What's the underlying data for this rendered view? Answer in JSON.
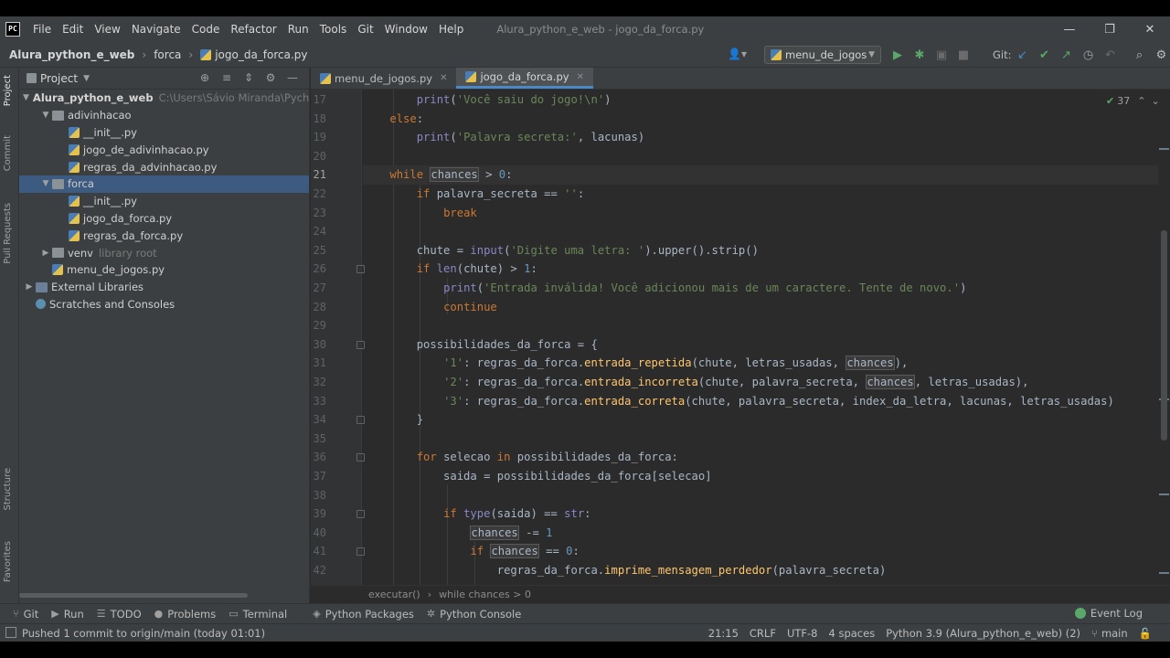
{
  "menubar": {
    "logo": "PC",
    "items": [
      "File",
      "Edit",
      "View",
      "Navigate",
      "Code",
      "Refactor",
      "Run",
      "Tools",
      "Git",
      "Window",
      "Help"
    ],
    "window_title": "Alura_python_e_web - jogo_da_forca.py"
  },
  "navbar": {
    "crumbs": [
      "Alura_python_e_web",
      "forca",
      "jogo_da_forca.py"
    ],
    "run_config": "menu_de_jogos",
    "git_label": "Git:"
  },
  "tool_strips": {
    "project": "Project",
    "commit": "Commit",
    "pull_requests": "Pull Requests",
    "structure": "Structure",
    "favorites": "Favorites"
  },
  "project": {
    "header": "Project",
    "tree": [
      {
        "label": "Alura_python_e_web",
        "hint": "C:\\Users\\Sávio Miranda\\PycharmProjects",
        "type": "folder",
        "arrow": "▼",
        "level": 0,
        "bold": true
      },
      {
        "label": "adivinhacao",
        "type": "folder",
        "arrow": "▼",
        "level": 1
      },
      {
        "label": "__init__.py",
        "type": "py",
        "level": 2
      },
      {
        "label": "jogo_de_adivinhacao.py",
        "type": "py",
        "level": 2
      },
      {
        "label": "regras_da_advinhacao.py",
        "type": "py",
        "level": 2
      },
      {
        "label": "forca",
        "type": "folder",
        "arrow": "▼",
        "level": 1,
        "selected": true
      },
      {
        "label": "__init__.py",
        "type": "py",
        "level": 2
      },
      {
        "label": "jogo_da_forca.py",
        "type": "py",
        "level": 2
      },
      {
        "label": "regras_da_forca.py",
        "type": "py",
        "level": 2
      },
      {
        "label": "venv",
        "hint": "library root",
        "type": "folder",
        "arrow": "▶",
        "level": 1
      },
      {
        "label": "menu_de_jogos.py",
        "type": "py",
        "level": 1
      },
      {
        "label": "External Libraries",
        "type": "lib",
        "arrow": "▶",
        "level": 0
      },
      {
        "label": "Scratches and Consoles",
        "type": "scratch",
        "level": 0
      }
    ]
  },
  "tabs": [
    {
      "label": "menu_de_jogos.py",
      "active": false
    },
    {
      "label": "jogo_da_forca.py",
      "active": true
    }
  ],
  "editor": {
    "inspection_count": "37",
    "lines": [
      {
        "n": "17",
        "tokens": [
          [
            "",
            "        "
          ],
          [
            "fn2",
            "print"
          ],
          [
            "",
            "("
          ],
          [
            "str",
            "'Você saiu do jogo!\\n'"
          ],
          [
            "",
            ")"
          ]
        ]
      },
      {
        "n": "18",
        "tokens": [
          [
            "",
            "    "
          ],
          [
            "kw",
            "else"
          ],
          [
            "",
            ":"
          ]
        ]
      },
      {
        "n": "19",
        "tokens": [
          [
            "",
            "        "
          ],
          [
            "fn2",
            "print"
          ],
          [
            "",
            "("
          ],
          [
            "str",
            "'Palavra secreta:'"
          ],
          [
            "",
            ", lacunas)"
          ]
        ]
      },
      {
        "n": "20",
        "tokens": []
      },
      {
        "n": "21",
        "tokens": [
          [
            "",
            "    "
          ],
          [
            "kw",
            "while "
          ],
          [
            "hl",
            "chances"
          ],
          [
            "",
            " > "
          ],
          [
            "num",
            "0"
          ],
          [
            "",
            ":"
          ]
        ]
      },
      {
        "n": "22",
        "tokens": [
          [
            "",
            "        "
          ],
          [
            "kw",
            "if "
          ],
          [
            "",
            "palavra_secreta == "
          ],
          [
            "str",
            "''"
          ],
          [
            "",
            ":"
          ]
        ]
      },
      {
        "n": "23",
        "tokens": [
          [
            "",
            "            "
          ],
          [
            "kw",
            "break"
          ]
        ]
      },
      {
        "n": "24",
        "tokens": []
      },
      {
        "n": "25",
        "tokens": [
          [
            "",
            "        chute = "
          ],
          [
            "fn2",
            "input"
          ],
          [
            "",
            "("
          ],
          [
            "str",
            "'Digite uma letra: '"
          ],
          [
            "",
            ").upper().strip()"
          ]
        ]
      },
      {
        "n": "26",
        "tokens": [
          [
            "",
            "        "
          ],
          [
            "kw",
            "if "
          ],
          [
            "bi",
            "len"
          ],
          [
            "",
            "(chute) > "
          ],
          [
            "num",
            "1"
          ],
          [
            "",
            ":"
          ]
        ]
      },
      {
        "n": "27",
        "tokens": [
          [
            "",
            "            "
          ],
          [
            "fn2",
            "print"
          ],
          [
            "",
            "("
          ],
          [
            "str",
            "'Entrada inválida! Você adicionou mais de um caractere. Tente de novo.'"
          ],
          [
            "",
            ")"
          ]
        ]
      },
      {
        "n": "28",
        "tokens": [
          [
            "",
            "            "
          ],
          [
            "kw",
            "continue"
          ]
        ]
      },
      {
        "n": "29",
        "tokens": []
      },
      {
        "n": "30",
        "tokens": [
          [
            "",
            "        possibilidades_da_forca = {"
          ]
        ]
      },
      {
        "n": "31",
        "tokens": [
          [
            "",
            "            "
          ],
          [
            "str",
            "'1'"
          ],
          [
            "",
            ": regras_da_forca."
          ],
          [
            "fn",
            "entrada_repetida"
          ],
          [
            "",
            "(chute, letras_usadas, "
          ],
          [
            "hl",
            "chances"
          ],
          [
            "",
            "),"
          ]
        ]
      },
      {
        "n": "32",
        "tokens": [
          [
            "",
            "            "
          ],
          [
            "str",
            "'2'"
          ],
          [
            "",
            ": regras_da_forca."
          ],
          [
            "fn",
            "entrada_incorreta"
          ],
          [
            "",
            "(chute, palavra_secreta, "
          ],
          [
            "hl",
            "chances"
          ],
          [
            "",
            ", letras_usadas),"
          ]
        ]
      },
      {
        "n": "33",
        "tokens": [
          [
            "",
            "            "
          ],
          [
            "str",
            "'3'"
          ],
          [
            "",
            ": regras_da_forca."
          ],
          [
            "fn",
            "entrada_correta"
          ],
          [
            "",
            "(chute, palavra_secreta, index_da_letra, lacunas, letras_usadas)"
          ]
        ]
      },
      {
        "n": "34",
        "tokens": [
          [
            "",
            "        }"
          ]
        ]
      },
      {
        "n": "35",
        "tokens": []
      },
      {
        "n": "36",
        "tokens": [
          [
            "",
            "        "
          ],
          [
            "kw",
            "for "
          ],
          [
            "",
            "selecao "
          ],
          [
            "kw",
            "in "
          ],
          [
            "",
            "possibilidades_da_forca:"
          ]
        ]
      },
      {
        "n": "37",
        "tokens": [
          [
            "",
            "            saida = possibilidades_da_forca[selecao]"
          ]
        ]
      },
      {
        "n": "38",
        "tokens": []
      },
      {
        "n": "39",
        "tokens": [
          [
            "",
            "            "
          ],
          [
            "kw",
            "if "
          ],
          [
            "bi",
            "type"
          ],
          [
            "",
            "(saida) == "
          ],
          [
            "bi",
            "str"
          ],
          [
            "",
            ":"
          ]
        ]
      },
      {
        "n": "40",
        "tokens": [
          [
            "",
            "                "
          ],
          [
            "hl",
            "chances"
          ],
          [
            "",
            " -= "
          ],
          [
            "num",
            "1"
          ]
        ]
      },
      {
        "n": "41",
        "tokens": [
          [
            "",
            "                "
          ],
          [
            "kw",
            "if "
          ],
          [
            "hl",
            "chances"
          ],
          [
            "",
            " == "
          ],
          [
            "num",
            "0"
          ],
          [
            "",
            ":"
          ]
        ]
      },
      {
        "n": "42",
        "tokens": [
          [
            "",
            "                    regras_da_forca."
          ],
          [
            "fn",
            "imprime_mensagem_perdedor"
          ],
          [
            "",
            "(palavra_secreta)"
          ]
        ]
      }
    ]
  },
  "breadcrumbs": [
    "executar()",
    "while chances > 0"
  ],
  "bottombar": {
    "items": [
      "Git",
      "Run",
      "TODO",
      "Problems",
      "Terminal",
      "Python Packages",
      "Python Console"
    ],
    "event_log": "Event Log"
  },
  "statusbar": {
    "message": "Pushed 1 commit to origin/main (today 01:01)",
    "position": "21:15",
    "line_sep": "CRLF",
    "encoding": "UTF-8",
    "indent": "4 spaces",
    "interpreter": "Python 3.9 (Alura_python_e_web) (2)",
    "branch": "main"
  }
}
